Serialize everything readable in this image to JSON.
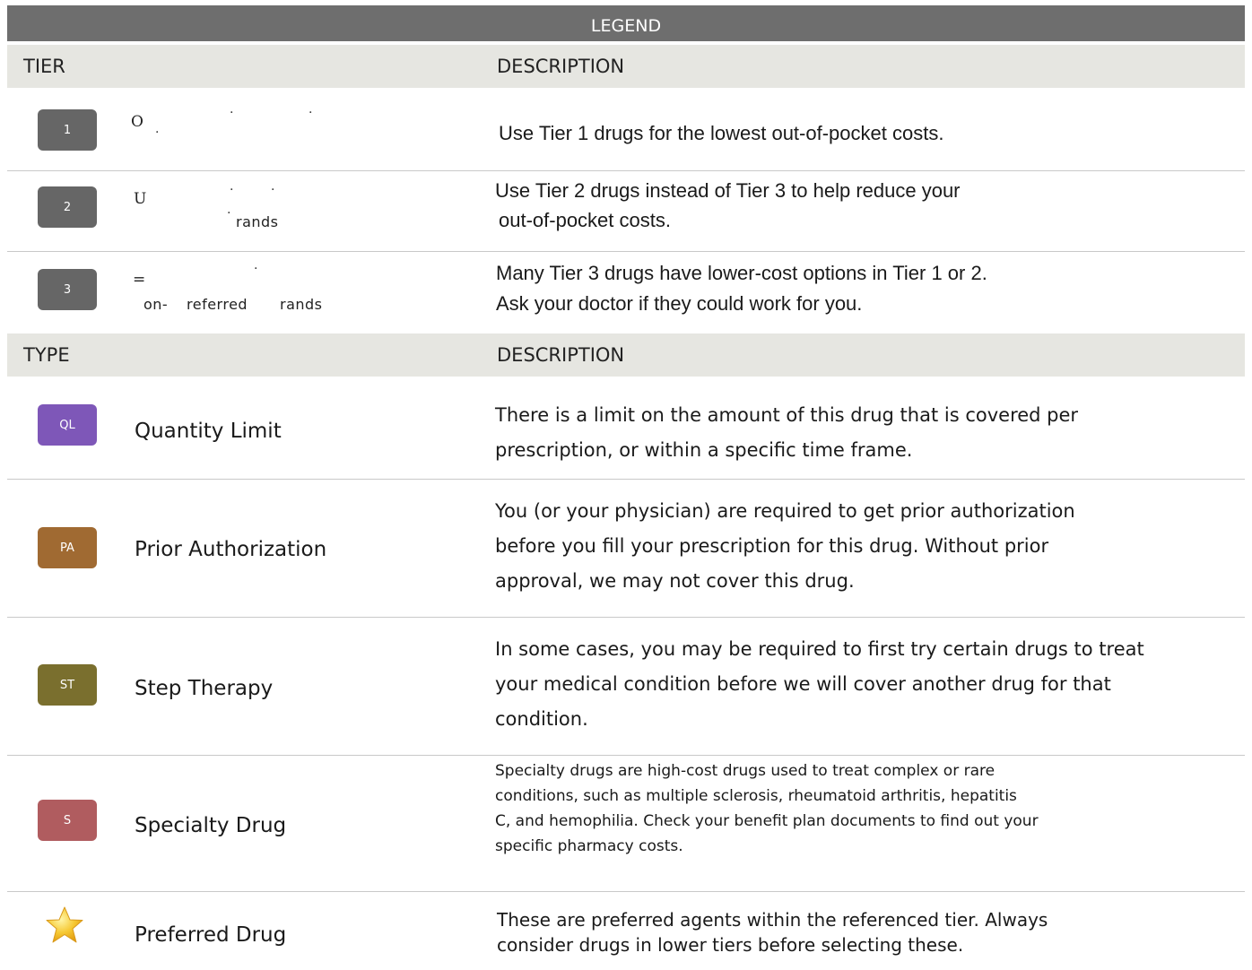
{
  "legend": {
    "title": "LEGEND"
  },
  "tier_header": {
    "left": "TIER",
    "right": "DESCRIPTION"
  },
  "type_header": {
    "left": "TYPE",
    "right": "DESCRIPTION"
  },
  "tiers": [
    {
      "badge": "1",
      "glyph": "O",
      "sub": "",
      "description_lines": [
        "Use Tier 1 drugs for the lowest out-of-pocket costs."
      ]
    },
    {
      "badge": "2",
      "glyph": "U",
      "sub": "rands",
      "description_lines": [
        "Use Tier 2 drugs instead of Tier 3 to help reduce your",
        "out-of-pocket costs."
      ]
    },
    {
      "badge": "3",
      "glyph": "=",
      "sub_parts": [
        "on-",
        "referred",
        "rands"
      ],
      "description_lines": [
        "Many Tier 3 drugs have lower-cost options in Tier 1 or 2.",
        "Ask your doctor if they could work for you."
      ]
    }
  ],
  "types": [
    {
      "badge": "QL",
      "color": "#7e57b8",
      "name": "Quantity Limit",
      "description_lines": [
        "There is a limit on the amount of this drug that is covered per",
        "prescription, or within a specific time frame."
      ]
    },
    {
      "badge": "PA",
      "color": "#a06a32",
      "name": "Prior Authorization",
      "description_lines": [
        "You (or your physician) are required to get prior authorization",
        "before you fill your prescription for this drug. Without prior",
        "approval, we may not cover this drug."
      ]
    },
    {
      "badge": "ST",
      "color": "#7a6f2e",
      "name": "Step Therapy",
      "description_lines": [
        "In some cases, you may be required to first try certain drugs to treat",
        "your medical condition before we will cover another drug for that",
        "condition."
      ]
    },
    {
      "badge": "S",
      "color": "#b05c5f",
      "name": "Specialty Drug",
      "description_lines": [
        "Specialty drugs are high-cost drugs used to treat complex or rare",
        "conditions, such as multiple sclerosis, rheumatoid arthritis, hepatitis",
        "C, and hemophilia. Check your benefit plan documents to find out your",
        "specific pharmacy costs."
      ]
    },
    {
      "icon": "star-icon",
      "name": "Preferred Drug",
      "description_lines": [
        "These are preferred agents within the referenced tier. Always",
        "consider drugs in lower tiers before selecting these."
      ]
    }
  ]
}
